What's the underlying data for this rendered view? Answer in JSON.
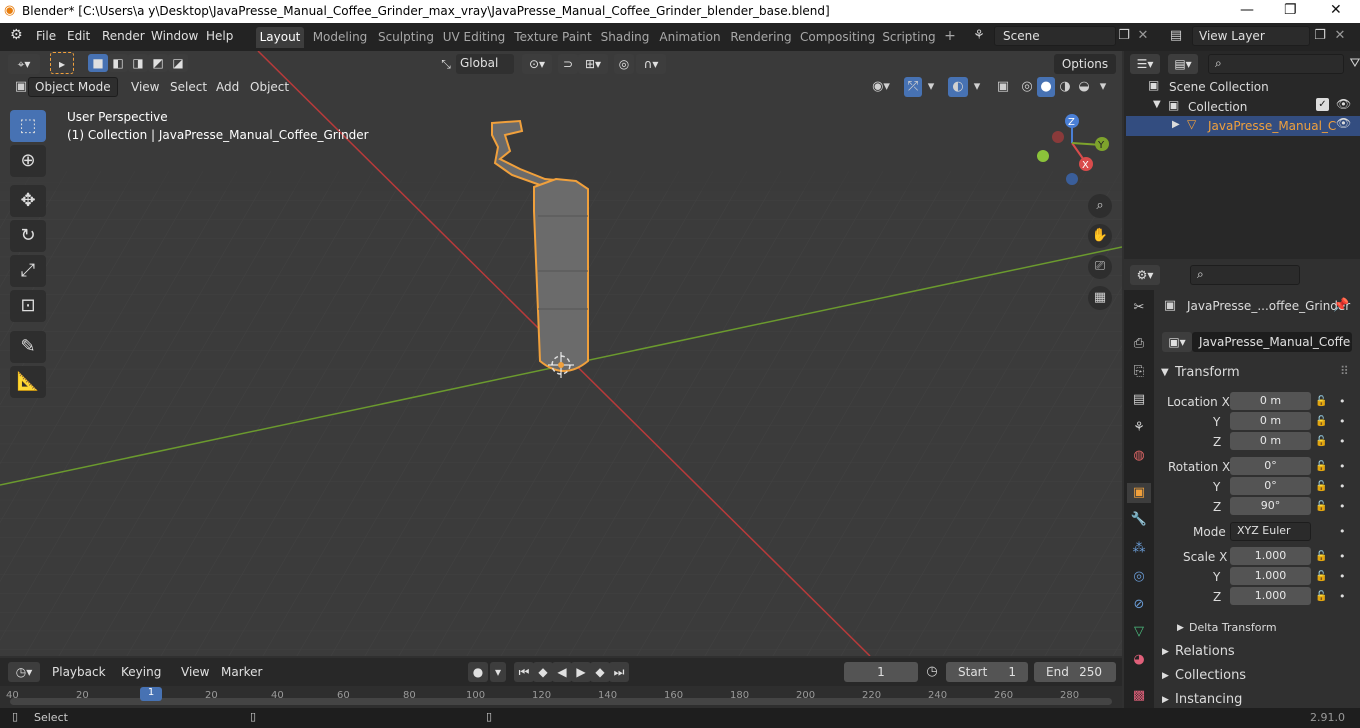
{
  "window": {
    "title": "Blender* [C:\\Users\\a y\\Desktop\\JavaPresse_Manual_Coffee_Grinder_max_vray\\JavaPresse_Manual_Coffee_Grinder_blender_base.blend]",
    "controls": [
      "—",
      "❐",
      "✕"
    ]
  },
  "menubar": {
    "menus": [
      "File",
      "Edit",
      "Render",
      "Window",
      "Help"
    ],
    "workspaces": [
      "Layout",
      "Modeling",
      "Sculpting",
      "UV Editing",
      "Texture Paint",
      "Shading",
      "Animation",
      "Rendering",
      "Compositing",
      "Scripting"
    ],
    "active_workspace": "Layout",
    "add_workspace": "+",
    "scene": "Scene",
    "view_layer": "View Layer"
  },
  "viewport_header": {
    "transform_orientation": "Global",
    "options": "Options",
    "mode": "Object Mode",
    "menus": [
      "View",
      "Select",
      "Add",
      "Object"
    ]
  },
  "viewport": {
    "perspective": "User Perspective",
    "collection_info": "(1) Collection | JavaPresse_Manual_Coffee_Grinder",
    "gizmo": {
      "x": "X",
      "y": "Y",
      "z": "Z"
    },
    "colors": {
      "x_axis": "#b83a3a",
      "y_axis": "#6b9a2e",
      "selection": "#f0a03c",
      "grid_bg": "#3b3b3b"
    }
  },
  "tools": [
    "select-box",
    "cursor",
    "move",
    "rotate",
    "scale",
    "transform",
    "annotate",
    "measure"
  ],
  "timeline": {
    "menus": [
      "Playback",
      "Keying",
      "View",
      "Marker"
    ],
    "current_frame": "1",
    "start_label": "Start",
    "start": "1",
    "end_label": "End",
    "end": "250",
    "ticks": [
      "40",
      "20",
      "1",
      "20",
      "40",
      "60",
      "80",
      "100",
      "120",
      "140",
      "160",
      "180",
      "200",
      "220",
      "240",
      "260",
      "280"
    ]
  },
  "outliner": {
    "scene_collection": "Scene Collection",
    "collection": "Collection",
    "object": "JavaPresse_Manual_C"
  },
  "properties": {
    "object_name": "JavaPresse_...offee_Grinder",
    "data_name": "JavaPresse_Manual_Coffee_...",
    "transform_label": "Transform",
    "location_label": "Location X",
    "rotation_label": "Rotation X",
    "scale_label": "Scale X",
    "y_label": "Y",
    "z_label": "Z",
    "location": [
      "0 m",
      "0 m",
      "0 m"
    ],
    "rotation": [
      "0°",
      "0°",
      "90°"
    ],
    "mode_label": "Mode",
    "mode": "XYZ Euler",
    "scale": [
      "1.000",
      "1.000",
      "1.000"
    ],
    "delta_transform": "Delta Transform",
    "relations": "Relations",
    "collections": "Collections",
    "instancing": "Instancing"
  },
  "status": {
    "left": "Select",
    "version": "2.91.0"
  }
}
